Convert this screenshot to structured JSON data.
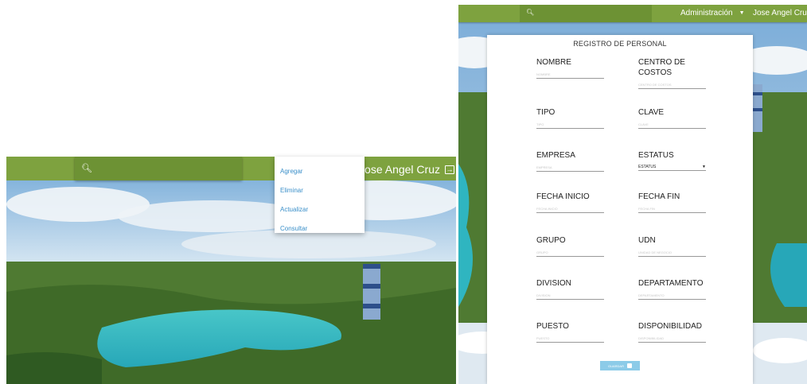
{
  "left": {
    "user_name": "Jose Angel Cruz",
    "menu": [
      "Agregar",
      "Eliminar",
      "Actualizar",
      "Consultar"
    ]
  },
  "right": {
    "nav": {
      "admin_label": "Administración",
      "user_name": "Jose Angel Cruz"
    },
    "form": {
      "title": "REGISTRO DE PERSONAL",
      "fields": [
        {
          "label": "NOMBRE",
          "placeholder": "NOMBRE"
        },
        {
          "label": "CENTRO DE COSTOS",
          "placeholder": "CENTRO DE COSTOS"
        },
        {
          "label": "TIPO",
          "placeholder": "TIPO"
        },
        {
          "label": "CLAVE",
          "placeholder": "CLAVE"
        },
        {
          "label": "EMPRESA",
          "placeholder": "EMPRESA"
        },
        {
          "label": "ESTATUS",
          "value": "ESTATUS"
        },
        {
          "label": "FECHA INICIO",
          "placeholder": "FECHA INICIO"
        },
        {
          "label": "FECHA FIN",
          "placeholder": "FECHA FIN"
        },
        {
          "label": "GRUPO",
          "placeholder": "GRUPO"
        },
        {
          "label": "UDN",
          "placeholder": "UNIDAD DE NEGOCIO"
        },
        {
          "label": "DIVISION",
          "placeholder": "DIVISION"
        },
        {
          "label": "DEPARTAMENTO",
          "placeholder": "DEPARTAMENTO"
        },
        {
          "label": "PUESTO",
          "placeholder": "PUESTO"
        },
        {
          "label": "DISPONIBILIDAD",
          "placeholder": "DISPONIBILIDAD"
        }
      ],
      "save_label": "GUARDAR"
    }
  },
  "colors": {
    "nav": "#7ea23f",
    "link": "#3a8fc9",
    "button": "#8ccbe8"
  }
}
